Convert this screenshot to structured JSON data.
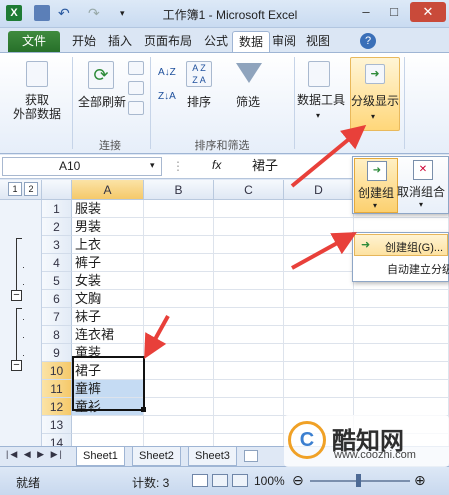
{
  "titlebar": {
    "title": "工作簿1 - Microsoft Excel",
    "minimize": "–",
    "maximize": "□",
    "close": "✕"
  },
  "tabs": [
    "文件",
    "开始",
    "插入",
    "页面布局",
    "公式",
    "数据",
    "审阅",
    "视图"
  ],
  "ribbon": {
    "get_external": "获取",
    "get_external2": "外部数据",
    "refresh_all": "全部刷新",
    "group_connect": "连接",
    "sort": "排序",
    "filter": "筛选",
    "group_sortfilter": "排序和筛选",
    "data_tools": "数据工具",
    "outline": "分级显示",
    "sort_az": "A↓Z",
    "sort_za": "Z↓A"
  },
  "formula": {
    "namebox": "A10",
    "fx": "fx",
    "value": "裙子"
  },
  "columns": [
    "A",
    "B",
    "C",
    "D"
  ],
  "outline_levels": [
    "1",
    "2"
  ],
  "rows": [
    {
      "n": "1",
      "a": "服装"
    },
    {
      "n": "2",
      "a": "男装"
    },
    {
      "n": "3",
      "a": "上衣"
    },
    {
      "n": "4",
      "a": "裤子"
    },
    {
      "n": "5",
      "a": "女装"
    },
    {
      "n": "6",
      "a": "文胸"
    },
    {
      "n": "7",
      "a": "袜子"
    },
    {
      "n": "8",
      "a": "连衣裙"
    },
    {
      "n": "9",
      "a": "童装"
    },
    {
      "n": "10",
      "a": "裙子"
    },
    {
      "n": "11",
      "a": "童裤"
    },
    {
      "n": "12",
      "a": "童衫"
    },
    {
      "n": "13",
      "a": ""
    },
    {
      "n": "14",
      "a": ""
    }
  ],
  "sheets": [
    "Sheet1",
    "Sheet2",
    "Sheet3"
  ],
  "status": {
    "ready": "就绪",
    "count": "计数: 3",
    "zoom": "100%"
  },
  "popup": {
    "group": "创建组",
    "ungroup": "取消组合"
  },
  "menu": {
    "create_group": "创建组(G)...",
    "auto_outline": "自动建立分级"
  },
  "watermark": {
    "brand": "酷知网",
    "url": "www.coozhi.com"
  },
  "colors": {
    "accent": "#e8403a",
    "selection": "#c5dbf3",
    "file_tab": "#2f7d32"
  }
}
